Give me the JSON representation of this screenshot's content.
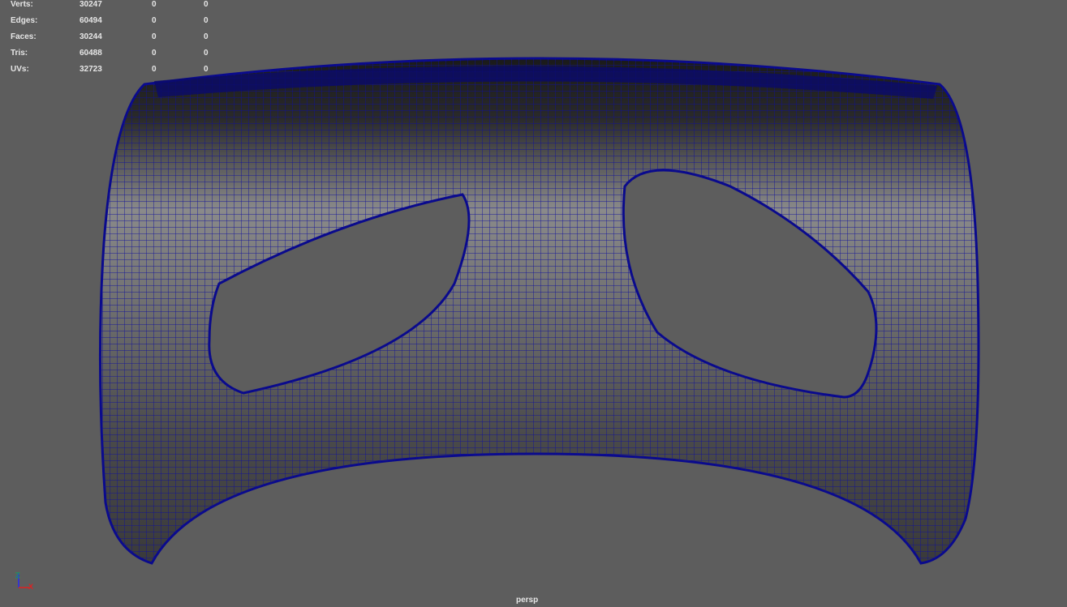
{
  "hud": {
    "rows": [
      {
        "label": "Verts:",
        "total": "30247",
        "selected": "0",
        "extra": "0"
      },
      {
        "label": "Edges:",
        "total": "60494",
        "selected": "0",
        "extra": "0"
      },
      {
        "label": "Faces:",
        "total": "30244",
        "selected": "0",
        "extra": "0"
      },
      {
        "label": "Tris:",
        "total": "60488",
        "selected": "0",
        "extra": "0"
      },
      {
        "label": "UVs:",
        "total": "32723",
        "selected": "0",
        "extra": "0"
      }
    ]
  },
  "viewport": {
    "camera": "persp",
    "background": "#5d5d5d",
    "wireframe_color": "#0a0a8c"
  },
  "axis": {
    "x": "X",
    "z": "Z"
  }
}
